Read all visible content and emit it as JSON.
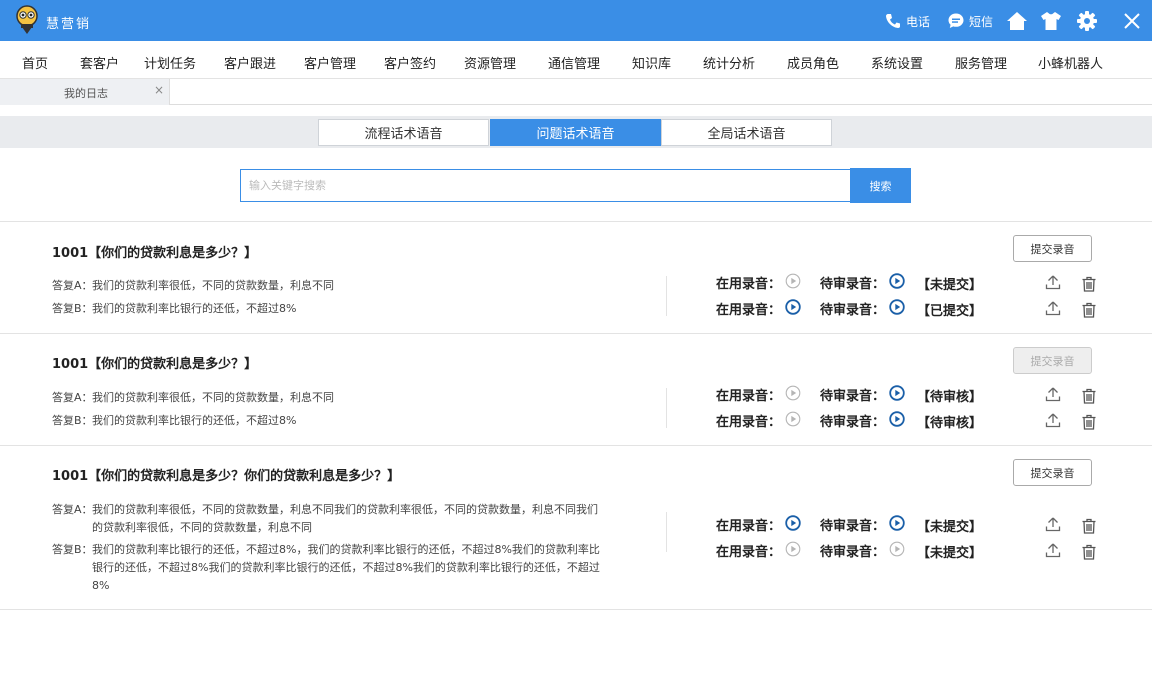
{
  "app": {
    "name": "慧营销",
    "phone_label": "电话",
    "sms_label": "短信"
  },
  "nav": [
    "首页",
    "套客户",
    "计划任务",
    "客户跟进",
    "客户管理",
    "客户签约",
    "资源管理",
    "通信管理",
    "知识库",
    "统计分析",
    "成员角色",
    "系统设置",
    "服务管理",
    "小蜂机器人"
  ],
  "page_tab": {
    "label": "我的日志",
    "close": "×"
  },
  "segments": [
    {
      "label": "流程话术语音",
      "active": false
    },
    {
      "label": "问题话术语音",
      "active": true
    },
    {
      "label": "全局话术语音",
      "active": false
    }
  ],
  "search": {
    "placeholder": "输入关键字搜索",
    "button": "搜索"
  },
  "labels": {
    "in_use": "在用录音：",
    "pending": "待审录音：",
    "submit": "提交录音"
  },
  "colors": {
    "primary": "#3a8ee6",
    "active_play": "#1a5fa8",
    "inactive_play": "#b5b5b5"
  },
  "questions": [
    {
      "title": "1001【你们的贷款利息是多少？】",
      "submit_disabled": false,
      "answers": [
        {
          "prefix": "答复A：",
          "text": "我们的贷款利率很低，不同的贷款数量，利息不同"
        },
        {
          "prefix": "答复B：",
          "text": "我们的贷款利率比银行的还低，不超过8%"
        }
      ],
      "records": [
        {
          "in_use_active": false,
          "pending_active": true,
          "status": "【未提交】"
        },
        {
          "in_use_active": true,
          "pending_active": true,
          "status": "【已提交】"
        }
      ]
    },
    {
      "title": "1001【你们的贷款利息是多少？】",
      "submit_disabled": true,
      "answers": [
        {
          "prefix": "答复A：",
          "text": "我们的贷款利率很低，不同的贷款数量，利息不同"
        },
        {
          "prefix": "答复B：",
          "text": "我们的贷款利率比银行的还低，不超过8%"
        }
      ],
      "records": [
        {
          "in_use_active": false,
          "pending_active": true,
          "status": "【待审核】"
        },
        {
          "in_use_active": false,
          "pending_active": true,
          "status": "【待审核】"
        }
      ]
    },
    {
      "title": "1001【你们的贷款利息是多少？你们的贷款利息是多少？】",
      "submit_disabled": false,
      "answers": [
        {
          "prefix": "答复A：",
          "text": "我们的贷款利率很低，不同的贷款数量，利息不同我们的贷款利率很低，不同的贷款数量，利息不同我们的贷款利率很低，不同的贷款数量，利息不同"
        },
        {
          "prefix": "答复B：",
          "text": "我们的贷款利率比银行的还低，不超过8%，我们的贷款利率比银行的还低，不超过8%我们的贷款利率比银行的还低，不超过8%我们的贷款利率比银行的还低，不超过8%我们的贷款利率比银行的还低，不超过8%"
        }
      ],
      "records": [
        {
          "in_use_active": true,
          "pending_active": true,
          "status": "【未提交】"
        },
        {
          "in_use_active": false,
          "pending_active": false,
          "status": "【未提交】"
        }
      ]
    }
  ]
}
